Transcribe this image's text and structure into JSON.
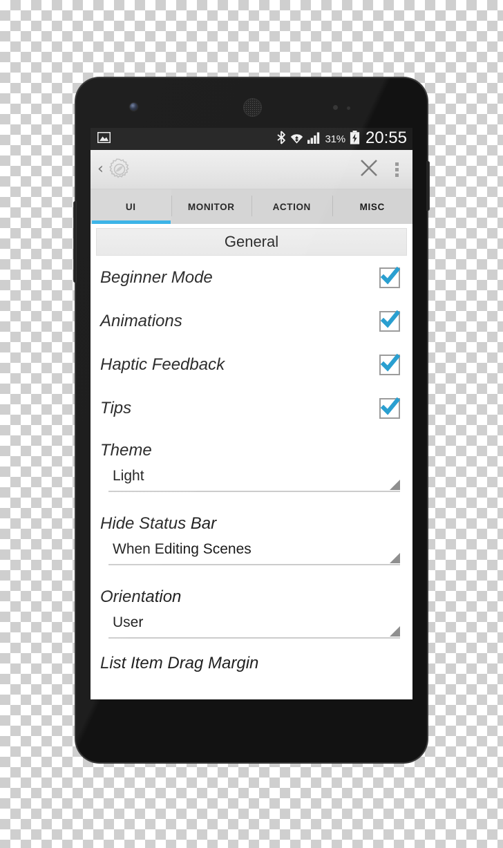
{
  "status_bar": {
    "left_icons": [
      "image-icon"
    ],
    "right_icons": [
      "bluetooth-icon",
      "wifi-icon",
      "signal-icon"
    ],
    "battery_percent": "31%",
    "battery_icon": "battery-charging-icon",
    "clock": "20:55"
  },
  "action_bar": {
    "back_label": "‹",
    "app_icon": "gear-icon",
    "close_icon": "close-icon",
    "overflow_icon": "overflow-menu-icon"
  },
  "tabs": [
    {
      "label": "UI",
      "selected": true
    },
    {
      "label": "MONITOR",
      "selected": false
    },
    {
      "label": "ACTION",
      "selected": false
    },
    {
      "label": "MISC",
      "selected": false
    }
  ],
  "colors": {
    "tab_indicator": "#32b0e6",
    "checkbox_check": "#2a9fd0",
    "status_bar_bg": "#1d1d1d",
    "tab_bar_bg": "#d3d3d3"
  },
  "content": {
    "section_header": "General",
    "toggles": [
      {
        "label": "Beginner Mode",
        "checked": true
      },
      {
        "label": "Animations",
        "checked": true
      },
      {
        "label": "Haptic Feedback",
        "checked": true
      },
      {
        "label": "Tips",
        "checked": true
      }
    ],
    "spinners": [
      {
        "label": "Theme",
        "value": "Light"
      },
      {
        "label": "Hide Status Bar",
        "value": "When Editing Scenes"
      },
      {
        "label": "Orientation",
        "value": "User"
      }
    ],
    "cutoff_item": "List Item Drag Margin"
  }
}
